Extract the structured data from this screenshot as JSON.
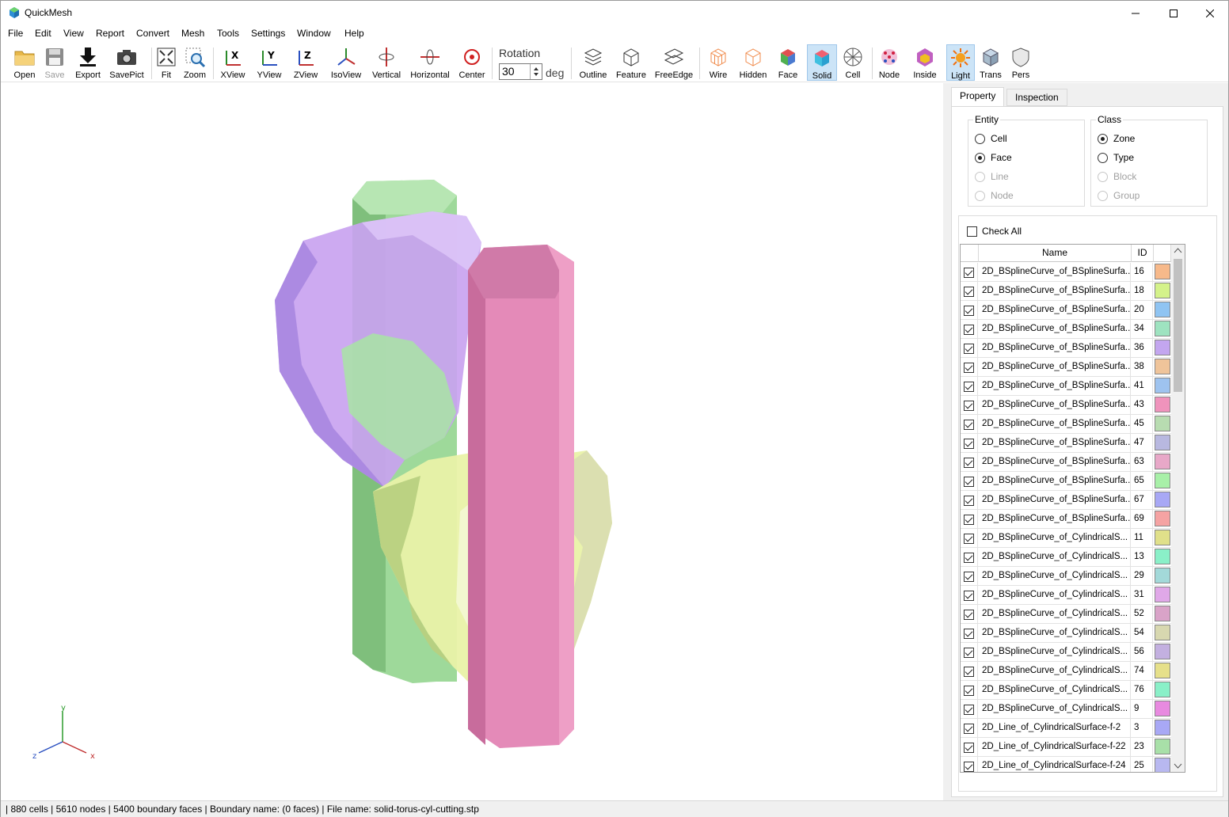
{
  "window": {
    "title": "QuickMesh"
  },
  "menu": [
    "File",
    "Edit",
    "View",
    "Report",
    "Convert",
    "Mesh",
    "Tools",
    "Settings",
    "Window",
    "Help"
  ],
  "toolbar": {
    "open": "Open",
    "save": "Save",
    "export": "Export",
    "savepict": "SavePict",
    "fit": "Fit",
    "zoom": "Zoom",
    "xview": "XView",
    "yview": "YView",
    "zview": "ZView",
    "isoview": "IsoView",
    "vertical": "Vertical",
    "horizontal": "Horizontal",
    "center": "Center",
    "rotation_label": "Rotation",
    "rotation_value": "30",
    "rotation_unit": "deg",
    "outline": "Outline",
    "feature": "Feature",
    "freeedge": "FreeEdge",
    "wire": "Wire",
    "hidden": "Hidden",
    "face": "Face",
    "solid": "Solid",
    "cell": "Cell",
    "node": "Node",
    "inside": "Inside",
    "light": "Light",
    "trans": "Trans",
    "pers": "Pers"
  },
  "viewport": {
    "axes": {
      "y": "y",
      "x": "x",
      "z": "z"
    },
    "colors": {
      "green": "#9ed99a",
      "purple": "#c9a3f0",
      "pink": "#e48ab8",
      "yellow": "#e9f2a8"
    }
  },
  "panel": {
    "tabs": [
      "Property",
      "Inspection"
    ],
    "entity": {
      "title": "Entity",
      "options": [
        {
          "label": "Cell",
          "selected": false,
          "enabled": true
        },
        {
          "label": "Face",
          "selected": true,
          "enabled": true
        },
        {
          "label": "Line",
          "selected": false,
          "enabled": false
        },
        {
          "label": "Node",
          "selected": false,
          "enabled": false
        }
      ]
    },
    "class": {
      "title": "Class",
      "options": [
        {
          "label": "Zone",
          "selected": true,
          "enabled": true
        },
        {
          "label": "Type",
          "selected": false,
          "enabled": true
        },
        {
          "label": "Block",
          "selected": false,
          "enabled": false
        },
        {
          "label": "Group",
          "selected": false,
          "enabled": false
        }
      ]
    },
    "check_all": "Check All",
    "columns": {
      "name": "Name",
      "id": "ID"
    },
    "rows": [
      {
        "name": "2D_BSplineCurve_of_BSplineSurfa...",
        "id": "16",
        "color": "#f7b98a",
        "checked": true
      },
      {
        "name": "2D_BSplineCurve_of_BSplineSurfa...",
        "id": "18",
        "color": "#d4f28a",
        "checked": true
      },
      {
        "name": "2D_BSplineCurve_of_BSplineSurfa...",
        "id": "20",
        "color": "#8fc4f2",
        "checked": true
      },
      {
        "name": "2D_BSplineCurve_of_BSplineSurfa...",
        "id": "34",
        "color": "#9ee3c0",
        "checked": true
      },
      {
        "name": "2D_BSplineCurve_of_BSplineSurfa...",
        "id": "36",
        "color": "#c3a6ef",
        "checked": true
      },
      {
        "name": "2D_BSplineCurve_of_BSplineSurfa...",
        "id": "38",
        "color": "#efc49a",
        "checked": true
      },
      {
        "name": "2D_BSplineCurve_of_BSplineSurfa...",
        "id": "41",
        "color": "#9ec3ef",
        "checked": true
      },
      {
        "name": "2D_BSplineCurve_of_BSplineSurfa...",
        "id": "43",
        "color": "#ef93bc",
        "checked": true
      },
      {
        "name": "2D_BSplineCurve_of_BSplineSurfa...",
        "id": "45",
        "color": "#b8dcb1",
        "checked": true
      },
      {
        "name": "2D_BSplineCurve_of_BSplineSurfa...",
        "id": "47",
        "color": "#b8b8e0",
        "checked": true
      },
      {
        "name": "2D_BSplineCurve_of_BSplineSurfa...",
        "id": "63",
        "color": "#e8a8c8",
        "checked": true
      },
      {
        "name": "2D_BSplineCurve_of_BSplineSurfa...",
        "id": "65",
        "color": "#a8f0a8",
        "checked": true
      },
      {
        "name": "2D_BSplineCurve_of_BSplineSurfa...",
        "id": "67",
        "color": "#a8a8f5",
        "checked": true
      },
      {
        "name": "2D_BSplineCurve_of_BSplineSurfa...",
        "id": "69",
        "color": "#f5a3a3",
        "checked": true
      },
      {
        "name": "2D_BSplineCurve_of_CylindricalS...",
        "id": "11",
        "color": "#e0e08a",
        "checked": true
      },
      {
        "name": "2D_BSplineCurve_of_CylindricalS...",
        "id": "13",
        "color": "#8af0c8",
        "checked": true
      },
      {
        "name": "2D_BSplineCurve_of_CylindricalS...",
        "id": "29",
        "color": "#a3d9d9",
        "checked": true
      },
      {
        "name": "2D_BSplineCurve_of_CylindricalS...",
        "id": "31",
        "color": "#e0a8e8",
        "checked": true
      },
      {
        "name": "2D_BSplineCurve_of_CylindricalS...",
        "id": "52",
        "color": "#d9a3c8",
        "checked": true
      },
      {
        "name": "2D_BSplineCurve_of_CylindricalS...",
        "id": "54",
        "color": "#d8d8b0",
        "checked": true
      },
      {
        "name": "2D_BSplineCurve_of_CylindricalS...",
        "id": "56",
        "color": "#c3b0e0",
        "checked": true
      },
      {
        "name": "2D_BSplineCurve_of_CylindricalS...",
        "id": "74",
        "color": "#e6e08a",
        "checked": true
      },
      {
        "name": "2D_BSplineCurve_of_CylindricalS...",
        "id": "76",
        "color": "#8af0c8",
        "checked": true
      },
      {
        "name": "2D_BSplineCurve_of_CylindricalS...",
        "id": "9",
        "color": "#e88ae0",
        "checked": true
      },
      {
        "name": "2D_Line_of_CylindricalSurface-f-2",
        "id": "3",
        "color": "#a8a8f5",
        "checked": true
      },
      {
        "name": "2D_Line_of_CylindricalSurface-f-22",
        "id": "23",
        "color": "#a8e0a8",
        "checked": true
      },
      {
        "name": "2D_Line_of_CylindricalSurface-f-24",
        "id": "25",
        "color": "#b8b8f0",
        "checked": true
      }
    ]
  },
  "status": "| 880 cells | 5610 nodes | 5400 boundary faces |  Boundary name:  (0 faces) | File name: solid-torus-cyl-cutting.stp"
}
